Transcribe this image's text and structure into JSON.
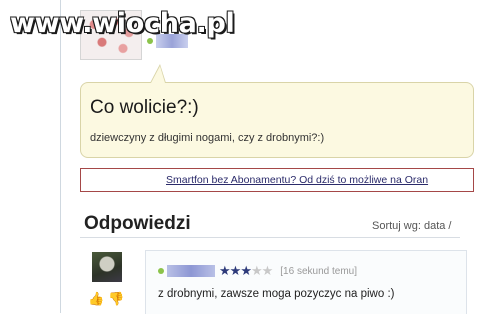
{
  "watermark": {
    "text": "www.wiocha.pl"
  },
  "asker": {
    "status_text": "online"
  },
  "question": {
    "title": "Co wolicie?:)",
    "body": "dziewczyny z długimi nogami, czy z drobnymi?:)"
  },
  "ad": {
    "link_text": "Smartfon bez Abonamentu? Od dziś to możliwe na Oran"
  },
  "answers_section": {
    "heading": "Odpowiedzi",
    "sort_label": "Sortuj wg: data /"
  },
  "answer": {
    "rating": 2.5,
    "rating_max": 5,
    "time_ago": "[16 sekund temu]",
    "text": "z drobnymi, zawsze moga pozyczyc na piwo :)"
  },
  "colors": {
    "question_bg": "#fcf9e1",
    "ad_border": "#a54848",
    "star_full": "#2d3a7a"
  },
  "icons": {
    "thumb_up": "thumb-up-icon",
    "thumb_down": "thumb-down-icon"
  }
}
